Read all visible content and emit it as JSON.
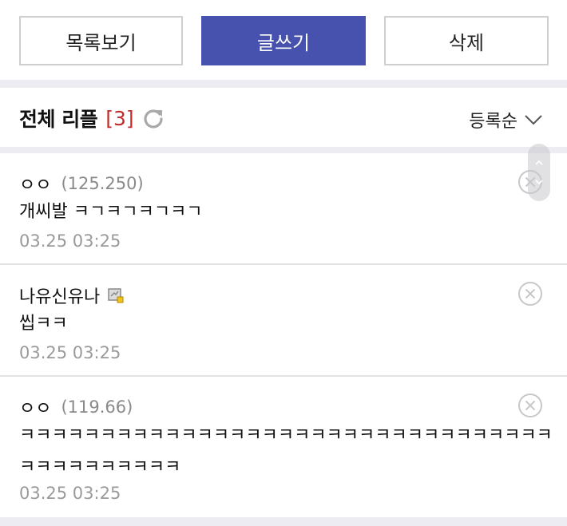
{
  "toolbar": {
    "list_label": "목록보기",
    "write_label": "글쓰기",
    "delete_label": "삭제"
  },
  "comments_header": {
    "title": "전체 리플",
    "count": "[3]",
    "sort_label": "등록순"
  },
  "comments": [
    {
      "name": "ㅇㅇ",
      "ip": "(125.250)",
      "body": "개씨발 ㅋㄱㅋㄱㅋㄱㅋㄱ",
      "date": "03.25 03:25"
    },
    {
      "name": "나유신유나",
      "ip": "",
      "body": "씹ㅋㅋ",
      "date": "03.25 03:25"
    },
    {
      "name": "ㅇㅇ",
      "ip": "(119.66)",
      "body": "ㅋㅋㅋㅋㅋㅋㅋㅋㅋㅋㅋㅋㅋㅋㅋㅋㅋㅋㅋㅋㅋㅋㅋㅋㅋㅋㅋㅋㅋㅋㅋㅋㅋㅋㅋㅋㅋㅋㅋㅋㅋㅋㅋ",
      "date": "03.25 03:25"
    }
  ],
  "colors": {
    "primary": "#4752ae",
    "count_red": "#c22b2b",
    "separator": "#ececf2"
  },
  "icons": {
    "refresh": "refresh-icon",
    "sort": "chevron-down-icon",
    "delete": "close-circle-icon",
    "level": "member-level-icon"
  }
}
